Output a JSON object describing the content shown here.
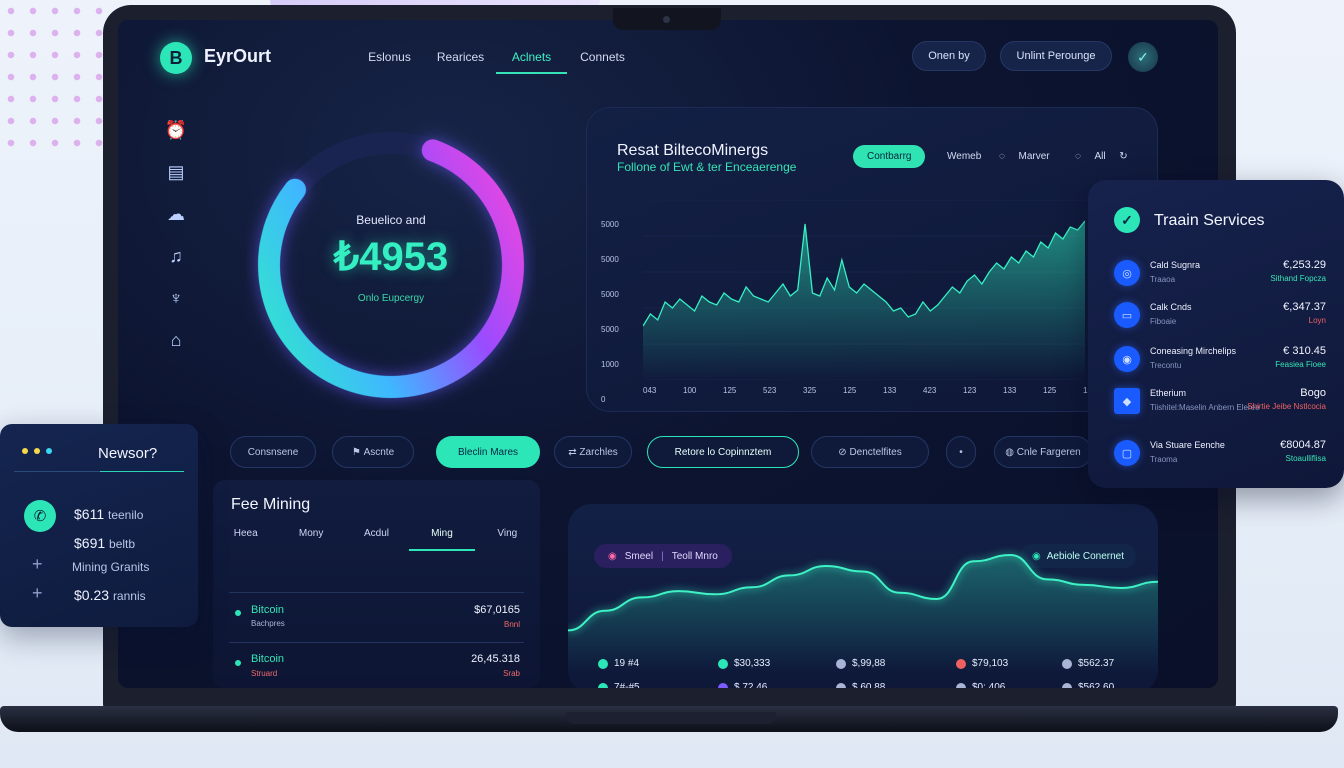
{
  "brand": {
    "logo_letter": "B",
    "name": "EyrOurt"
  },
  "nav": [
    {
      "label": "Eslonus",
      "active": false
    },
    {
      "label": "Rearices",
      "active": false
    },
    {
      "label": "Aclnets",
      "active": true
    },
    {
      "label": "Connets",
      "active": false
    }
  ],
  "header": {
    "button1": "Onen by",
    "button2": "Unlint Perounge",
    "avatar_glyph": "✓"
  },
  "gauge": {
    "label": "Beuelico and",
    "value": "₺4953",
    "sub": "Onlo Eupcergy",
    "percent": 0.8
  },
  "chart_card": {
    "title": "Resat BiltecoMinergs",
    "subtitle": "Follone of Ewt & ter Enceaerenge",
    "filters": [
      "Contbarrg",
      "Wemeb",
      "Marver",
      "All"
    ],
    "active_filter": 0
  },
  "chart_data": {
    "type": "area",
    "y_ticks": [
      "5000",
      "5000",
      "5000",
      "5000",
      "1000",
      "0"
    ],
    "x_ticks": [
      "043",
      "100",
      "125",
      "523",
      "325",
      "125",
      "133",
      "423",
      "123",
      "133",
      "125",
      "125"
    ],
    "ylim": [
      0,
      6000
    ],
    "values": [
      1800,
      2200,
      2000,
      2600,
      2400,
      2700,
      2500,
      2300,
      2800,
      2600,
      2500,
      2900,
      2700,
      2600,
      3100,
      2800,
      2700,
      2600,
      2900,
      3200,
      2800,
      3000,
      5200,
      2900,
      2800,
      3400,
      3000,
      4000,
      3100,
      2900,
      3200,
      3000,
      2800,
      2600,
      2300,
      2400,
      2100,
      2200,
      2600,
      2300,
      2500,
      2800,
      3100,
      2900,
      3300,
      3500,
      3200,
      3600,
      3900,
      3700,
      4100,
      3900,
      4300,
      4100,
      4600,
      4400,
      4900,
      4700,
      5100,
      5000,
      5300
    ]
  },
  "services": {
    "title": "Traain Services",
    "items": [
      {
        "name": "Cald Sugnra",
        "sub": "Traaoa",
        "amount": "€,253.29",
        "change": "Sithand Fopcza",
        "change_color": "#36e6b3",
        "icon": "◎"
      },
      {
        "name": "Calk Cnds",
        "sub": "Fiboaie",
        "amount": "€,347.37",
        "change": "Loyn",
        "change_color": "#ef6060",
        "icon": "▭"
      },
      {
        "name": "Coneasing Mirchelips",
        "sub": "Trecontu",
        "amount": "€ 310.45",
        "change": "Feasiea Fioee",
        "change_color": "#36e6b3",
        "icon": "◉"
      },
      {
        "name": "Etherium",
        "sub": "Tiishitel:Maselin Anbern Eleree",
        "amount": "Bogo",
        "change": "Shirtie Jeibe Nstlcocia",
        "change_color": "#ef6060",
        "icon": "◆"
      },
      {
        "name": "Via Stuare Eenche",
        "sub": "Traoma",
        "amount": "€8004.87",
        "change": "Stoaulliflisa",
        "change_color": "#36e6b3",
        "icon": "▢"
      }
    ]
  },
  "newsor": {
    "title": "Newsor?",
    "rows": [
      {
        "amount": "$611",
        "label": "teenilo"
      },
      {
        "amount": "$691",
        "label": "beltb"
      },
      {
        "amount": "",
        "label": "Mining Granits"
      },
      {
        "amount": "$0.23",
        "label": "rannis"
      }
    ]
  },
  "filters": [
    "Consnsene",
    "Ascnte",
    "Bleclin Mares",
    "Zarchles",
    "Retore lo Copinnztem",
    "Denctelfites",
    "",
    "Cnle Fargeren"
  ],
  "mining": {
    "title": "Fee Mining",
    "tabs": [
      "Heea",
      "Mony",
      "Acdul",
      "Ming",
      "Ving"
    ],
    "active_tab": 3,
    "rows": [
      {
        "name": "Bitcoin",
        "sub": "Bachpres",
        "value": "$67,0165",
        "change": "Bnnl"
      },
      {
        "name": "Bitcoin",
        "sub": "Struard",
        "value": "26,45.318",
        "change": "Srab"
      }
    ]
  },
  "wave": {
    "pill": "Smeel",
    "pill2": "Teoll Mnro",
    "badge": "Aebiole Conernet",
    "values": [
      30,
      55,
      72,
      80,
      76,
      85,
      100,
      112,
      105,
      78,
      70,
      118,
      126,
      95,
      88,
      84,
      92
    ],
    "stats": [
      {
        "value": "19 #4",
        "color": "#2de6b8"
      },
      {
        "value": "$30,333",
        "color": "#2de6b8"
      },
      {
        "value": "$,99,88",
        "color": "#a9b4d6"
      },
      {
        "value": "$79,103",
        "color": "#ef6060"
      },
      {
        "value": "$562.37",
        "color": "#a9b4d6"
      },
      {
        "value": "7#-#5",
        "color": "#2de6b8"
      },
      {
        "value": "$,72,46",
        "color": "#7b5cff"
      },
      {
        "value": "$,60,88",
        "color": "#a9b4d6"
      },
      {
        "value": "$0:,406",
        "color": "#a9b4d6"
      },
      {
        "value": "$562.60",
        "color": "#a9b4d6"
      }
    ]
  }
}
